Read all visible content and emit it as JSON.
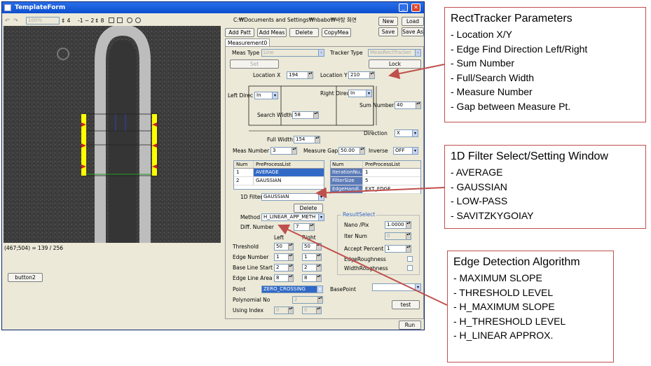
{
  "window": {
    "title": "TemplateForm",
    "toolbar": {
      "zoom": "100%",
      "v1": "4",
      "v2": "2",
      "v3": "8"
    },
    "status": "(467;504) = 139 / 256",
    "button2": "button2"
  },
  "right": {
    "path": "C:₩Documents and Settings₩hbabo₩바탕 화면",
    "buttons": {
      "add_patt": "Add Patt",
      "add_meas": "Add Meas",
      "delete": "Delete",
      "copy_mea": "CopyMea",
      "new": "New",
      "load": "Load",
      "save": "Save",
      "save_as": "Save As"
    },
    "tab": "Measurement0",
    "meas_type_label": "Meas Type",
    "meas_type_value": "Line",
    "tracker_type_label": "Tracker Type",
    "tracker_type_value": "MeasRectTracker",
    "set": "Set",
    "lock": "Lock",
    "location_x_label": "Location X",
    "location_x": "194",
    "location_y_label": "Location Y",
    "location_y": "210",
    "left_direc_label": "Left Direc",
    "left_direc": "In",
    "right_direc_label": "Right Direc",
    "right_direc": "In",
    "sum_number_label": "Sum Number",
    "sum_number": "40",
    "search_width_label": "Search Width",
    "search_width": "58",
    "direction_label": "Direction",
    "direction": "X",
    "full_width_label": "Full Width",
    "full_width": "154",
    "meas_number_label": "Meas Number",
    "meas_number": "3",
    "meas_gap_label": "Measure Gap",
    "meas_gap": "50.00",
    "inverse_label": "Inverse",
    "inverse": "OFF",
    "pre_grid": {
      "headers": [
        "Num",
        "PreProcessList"
      ],
      "rows": [
        [
          "1",
          "AVERAGE"
        ],
        [
          "2",
          "GAUSSIAN"
        ]
      ]
    },
    "param_grid": {
      "headers": [
        "Num",
        "PreProcessList"
      ],
      "rows": [
        [
          "IterationNu...",
          "1"
        ],
        [
          "FilterSize",
          "5"
        ],
        [
          "EdgeHandl...",
          "EXT_EDGE"
        ]
      ]
    },
    "filter_label": "1D Filter",
    "filter_value": "GAUSSIAN",
    "filter_delete": "Delete",
    "method_label": "Method",
    "method_value": "H_LINEAR_APP_METH",
    "diff_label": "Diff. Number",
    "diff_value": "7",
    "left_label": "Left",
    "right_label": "Right",
    "threshold_label": "Threshold",
    "threshold_left": "50",
    "threshold_right": "50",
    "edge_number_label": "Edge Number",
    "edge_left": "1",
    "edge_right": "1",
    "baseline_label": "Base Line Start P",
    "baseline_left": "2",
    "baseline_right": "2",
    "edge_area_label": "Edge Line Area",
    "area_left": "8",
    "area_right": "8",
    "result_select": "ResultSelect",
    "nano_label": "Nano /Pix",
    "nano": "1.0000",
    "iter_label": "Iter Num",
    "iter": "0",
    "accept_label": "Accept Percent",
    "accept": "1",
    "edge_rough": "EdgeRoughness",
    "width_rough": "WidthRoughness",
    "point_label": "Point",
    "point_value": "ZERO_CROSSING",
    "basepoint_label": "BasePoint",
    "poly_label": "Polynomial No",
    "poly": "2",
    "using_label": "Using Index",
    "using_a": "0",
    "using_b": "0",
    "test": "test",
    "run": "Run"
  },
  "notes": {
    "n1": {
      "title": "RectTracker Parameters",
      "items": [
        "- Location X/Y",
        "- Edge Find Direction Left/Right",
        "- Sum Number",
        "- Full/Search Width",
        "- Measure Number",
        "- Gap between Measure Pt."
      ]
    },
    "n2": {
      "title": "1D Filter Select/Setting Window",
      "items": [
        "- AVERAGE",
        "- GAUSSIAN",
        "- LOW-PASS",
        "- SAVITZKYGOIAY"
      ]
    },
    "n3": {
      "title": "Edge Detection Algorithm",
      "items": [
        "- MAXIMUM SLOPE",
        "- THRESHOLD LEVEL",
        "- H_MAXIMUM SLOPE",
        "- H_THRESHOLD LEVEL",
        "- H_LINEAR APPROX."
      ]
    }
  },
  "colors": {
    "annotation": "#c0504d",
    "title_bar": "#0b4fd0",
    "marker_yellow": "#ffff00"
  }
}
